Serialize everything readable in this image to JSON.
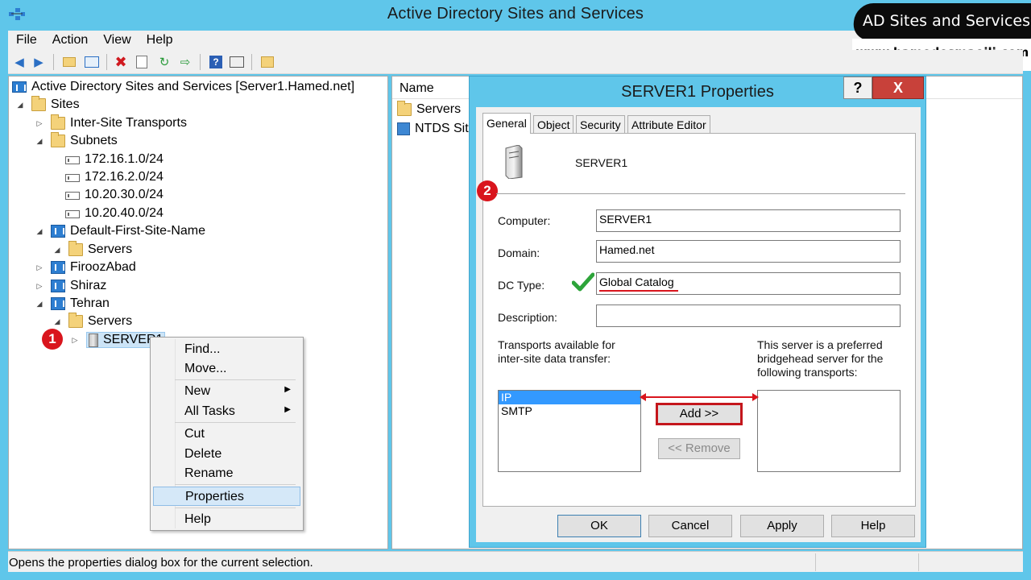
{
  "window": {
    "title": "Active Directory Sites and Services"
  },
  "watermark": {
    "badge": "AD Sites and Services",
    "url": "www.hamedesmaeili.com"
  },
  "menu": [
    "File",
    "Action",
    "View",
    "Help"
  ],
  "toolbar_icons": [
    "back-arrow-icon",
    "forward-arrow-icon",
    "up-folder-icon",
    "show-hide-tree-icon",
    "delete-icon",
    "properties-icon",
    "refresh-icon",
    "export-list-icon",
    "help-icon",
    "view-icon",
    "new-icon"
  ],
  "tree": {
    "root": "Active Directory Sites and Services [Server1.Hamed.net]",
    "sites": "Sites",
    "inter_site": "Inter-Site Transports",
    "subnets": "Subnets",
    "subnet_items": [
      "172.16.1.0/24",
      "172.16.2.0/24",
      "10.20.30.0/24",
      "10.20.40.0/24"
    ],
    "default_site": "Default-First-Site-Name",
    "servers": "Servers",
    "firoozabad": "FiroozAbad",
    "shiraz": "Shiraz",
    "tehran": "Tehran",
    "server1": "SERVER1"
  },
  "list": {
    "header": "Name",
    "items": [
      "Servers",
      "NTDS Site Settings"
    ]
  },
  "steps": {
    "one": "1",
    "two": "2"
  },
  "context_menu": {
    "find": "Find...",
    "move": "Move...",
    "new": "New",
    "all_tasks": "All Tasks",
    "cut": "Cut",
    "delete": "Delete",
    "rename": "Rename",
    "properties": "Properties",
    "help": "Help"
  },
  "status": "Opens the properties dialog box for the current selection.",
  "dialog": {
    "title": "SERVER1 Properties",
    "help": "?",
    "close": "X",
    "tabs": [
      "General",
      "Object",
      "Security",
      "Attribute Editor"
    ],
    "server_name": "SERVER1",
    "computer_label": "Computer:",
    "computer_value": "SERVER1",
    "domain_label": "Domain:",
    "domain_value": "Hamed.net",
    "dc_type_label": "DC Type:",
    "dc_type_value": "Global Catalog",
    "description_label": "Description:",
    "description_value": "",
    "transports_label": "Transports available for inter-site data transfer:",
    "transports": [
      "IP",
      "SMTP"
    ],
    "bridgehead_label": "This server is a preferred bridgehead server for the following transports:",
    "add": "Add >>",
    "remove": "<< Remove",
    "ok": "OK",
    "cancel": "Cancel",
    "apply": "Apply",
    "help_btn": "Help"
  },
  "colors": {
    "accent": "#5fc6ea",
    "close": "#c8413a",
    "marker": "#d9151d",
    "selection": "#3399ff"
  }
}
